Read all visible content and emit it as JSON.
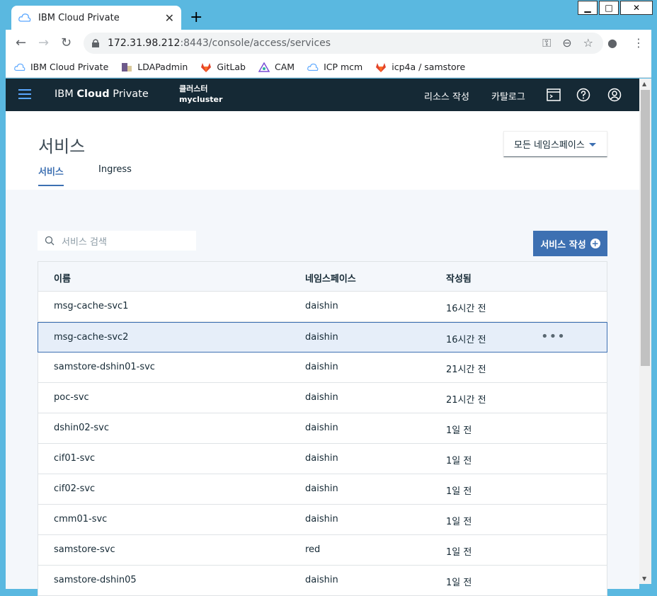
{
  "browser": {
    "tab_title": "IBM Cloud Private",
    "url_host": "172.31.98.212",
    "url_path": ":8443/console/access/services",
    "bookmarks": [
      {
        "label": "IBM Cloud Private",
        "icon": "cloud-icon"
      },
      {
        "label": "LDAPadmin",
        "icon": "ldap-icon"
      },
      {
        "label": "GitLab",
        "icon": "gitlab-icon"
      },
      {
        "label": "CAM",
        "icon": "cam-icon"
      },
      {
        "label": "ICP mcm",
        "icon": "cloud-icon"
      },
      {
        "label": "icp4a / samstore",
        "icon": "gitlab-icon"
      }
    ]
  },
  "header": {
    "brand_prefix": "IBM ",
    "brand_bold": "Cloud",
    "brand_suffix": " Private",
    "cluster_label": "클러스터",
    "cluster_name": "mycluster",
    "create_resource": "리소스 작성",
    "catalog": "카탈로그"
  },
  "page": {
    "title": "서비스",
    "tabs": [
      "서비스",
      "Ingress"
    ],
    "namespace_dropdown": "모든 네임스페이스",
    "search_placeholder": "서비스 검색",
    "create_button": "서비스 작성"
  },
  "table": {
    "columns": [
      "이름",
      "네임스페이스",
      "작성됨"
    ],
    "rows": [
      {
        "name": "msg-cache-svc1",
        "namespace": "daishin",
        "created": "16시간 전"
      },
      {
        "name": "msg-cache-svc2",
        "namespace": "daishin",
        "created": "16시간 전"
      },
      {
        "name": "samstore-dshin01-svc",
        "namespace": "daishin",
        "created": "21시간 전"
      },
      {
        "name": "poc-svc",
        "namespace": "daishin",
        "created": "21시간 전"
      },
      {
        "name": "dshin02-svc",
        "namespace": "daishin",
        "created": "1일 전"
      },
      {
        "name": "cif01-svc",
        "namespace": "daishin",
        "created": "1일 전"
      },
      {
        "name": "cif02-svc",
        "namespace": "daishin",
        "created": "1일 전"
      },
      {
        "name": "cmm01-svc",
        "namespace": "daishin",
        "created": "1일 전"
      },
      {
        "name": "samstore-svc",
        "namespace": "red",
        "created": "1일 전"
      },
      {
        "name": "samstore-dshin05",
        "namespace": "daishin",
        "created": "1일 전"
      }
    ]
  },
  "colors": {
    "header_bg": "#152935",
    "accent": "#3d70b2",
    "window_frame": "#5ab8e0"
  }
}
